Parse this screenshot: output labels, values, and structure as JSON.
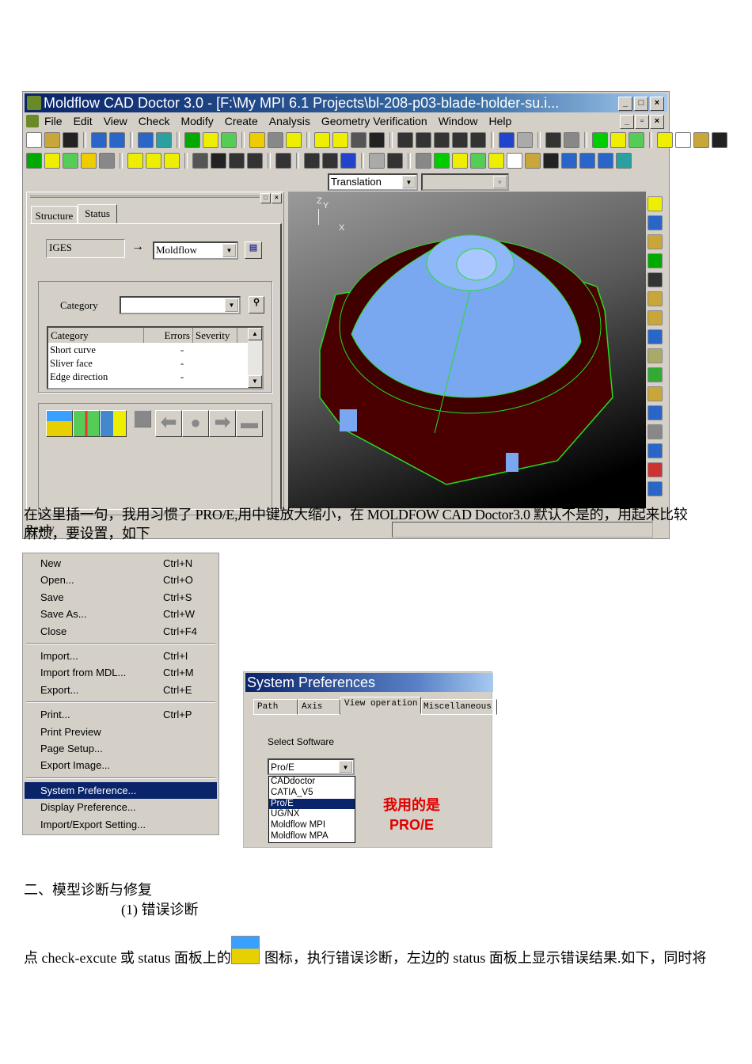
{
  "window": {
    "title": "Moldflow CAD Doctor 3.0 - [F:\\My MPI 6.1 Projects\\bl-208-p03-blade-holder-su.i...",
    "menu": [
      "File",
      "Edit",
      "View",
      "Check",
      "Modify",
      "Create",
      "Analysis",
      "Geometry Verification",
      "Window",
      "Help"
    ],
    "view_combo": "Translation",
    "status": "Ready"
  },
  "left_panel": {
    "tabs": [
      "Structure",
      "Status"
    ],
    "source": "IGES",
    "target": "Moldflow",
    "category_label": "Category",
    "category_value": "",
    "columns": [
      "Category",
      "Errors",
      "Severity"
    ],
    "rows": [
      {
        "category": "Short curve",
        "errors": "-"
      },
      {
        "category": "Sliver face",
        "errors": "-"
      },
      {
        "category": "Edge direction",
        "errors": "-"
      }
    ]
  },
  "viewport": {
    "axis_y": "Y",
    "axis_z": "Z",
    "axis_x": "X"
  },
  "note_line1": "在这里插一句，我用习惯了 PRO/E,用中键放大缩小，在 MOLDFOW CAD Doctor3.0 默认不是的，用起来比较",
  "note_line2": "麻烦，要设置，如下",
  "file_menu": [
    {
      "label": "New",
      "key": "Ctrl+N"
    },
    {
      "label": "Open...",
      "key": "Ctrl+O"
    },
    {
      "label": "Save",
      "key": "Ctrl+S"
    },
    {
      "label": "Save As...",
      "key": "Ctrl+W"
    },
    {
      "label": "Close",
      "key": "Ctrl+F4"
    },
    {
      "label": "Import...",
      "key": "Ctrl+I"
    },
    {
      "label": "Import from MDL...",
      "key": "Ctrl+M"
    },
    {
      "label": "Export...",
      "key": "Ctrl+E"
    },
    {
      "label": "Print...",
      "key": "Ctrl+P"
    },
    {
      "label": "Print Preview",
      "key": ""
    },
    {
      "label": "Page Setup...",
      "key": ""
    },
    {
      "label": "Export Image...",
      "key": ""
    },
    {
      "label": "System Preference...",
      "key": ""
    },
    {
      "label": "Display Preference...",
      "key": ""
    },
    {
      "label": "Import/Export Setting...",
      "key": ""
    }
  ],
  "prefs": {
    "title": "System Preferences",
    "tabs": [
      "Path",
      "Axis",
      "View operation",
      "Miscellaneous"
    ],
    "select_label": "Select Software",
    "selected": "Pro/E",
    "options": [
      "CADdoctor",
      "CATIA_V5",
      "Pro/E",
      "UG/NX",
      "Moldflow MPI",
      "Moldflow MPA"
    ],
    "annotation1": "我用的是",
    "annotation2": "PRO/E",
    "annotation_color": "#e00000"
  },
  "section_title": "二、模型诊断与修复",
  "subsection": "(1) 错误诊断",
  "para_before": "点 check-excute 或 status 面板上的",
  "para_after": "图标，执行错误诊断，左边的 status 面板上显示错误结果.如下，同时将"
}
